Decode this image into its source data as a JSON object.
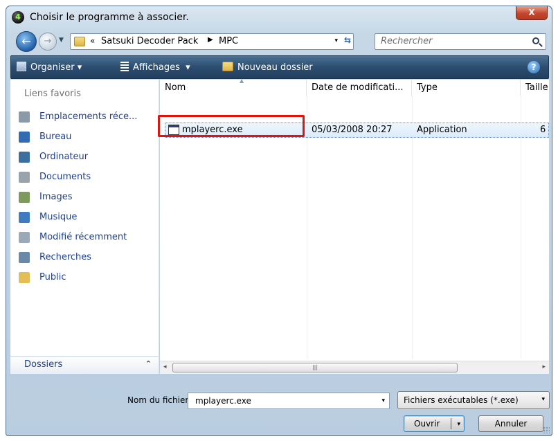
{
  "window": {
    "title": "Choisir le programme à associer.",
    "close_label": "X"
  },
  "address": {
    "overflow": "«",
    "crumbs": [
      "Satsuki Decoder Pack",
      "MPC"
    ],
    "separator": "▶",
    "dropdown": "▾",
    "refresh": "⇆"
  },
  "search": {
    "placeholder": "Rechercher"
  },
  "toolbar": {
    "organize_label": "Organiser",
    "views_label": "Affichages",
    "new_folder_label": "Nouveau dossier",
    "dropdown": "▾",
    "help": "?"
  },
  "nav": {
    "header": "Liens favoris",
    "items": [
      {
        "label": "Emplacements réce...",
        "icon": "recent-places-icon",
        "color": "#8a9aa8"
      },
      {
        "label": "Bureau",
        "icon": "desktop-icon",
        "color": "#2f6cb4"
      },
      {
        "label": "Ordinateur",
        "icon": "computer-icon",
        "color": "#3b6f9e"
      },
      {
        "label": "Documents",
        "icon": "documents-icon",
        "color": "#9aa2aa"
      },
      {
        "label": "Images",
        "icon": "pictures-icon",
        "color": "#7c9a5a"
      },
      {
        "label": "Musique",
        "icon": "music-icon",
        "color": "#3f7bbf"
      },
      {
        "label": "Modifié récemment",
        "icon": "recently-changed-icon",
        "color": "#9aa8b8"
      },
      {
        "label": "Recherches",
        "icon": "searches-icon",
        "color": "#6a88a8"
      },
      {
        "label": "Public",
        "icon": "public-folder-icon",
        "color": "#e3be55"
      }
    ],
    "folders_label": "Dossiers",
    "folders_chevron": "⌃"
  },
  "file_list": {
    "columns": [
      "Nom",
      "Date de modificati...",
      "Type",
      "Taille"
    ],
    "sort_indicator": "▲",
    "rows": [
      {
        "name": "mplayerc.exe",
        "date": "05/03/2008 20:27",
        "type": "Application",
        "size": "6"
      }
    ],
    "scroll_grip": "|||",
    "scroll_left": "◂",
    "scroll_right": "▸"
  },
  "footer": {
    "filename_label": "Nom du fichier :",
    "filename_value": "mplayerc.exe",
    "filter_value": "Fichiers exécutables (*.exe)",
    "combo_arrow": "▾",
    "open_label": "Ouvrir",
    "cancel_label": "Annuler"
  }
}
